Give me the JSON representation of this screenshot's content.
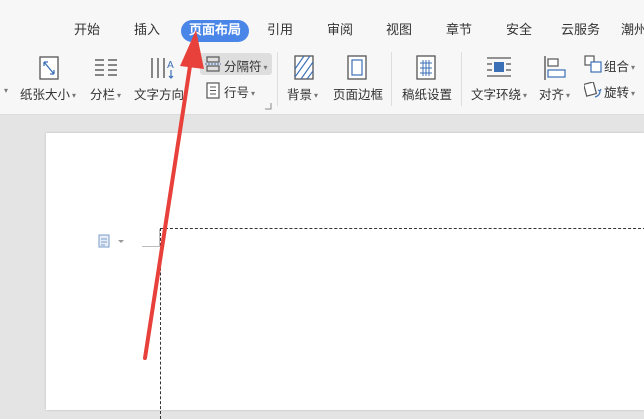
{
  "tabs": [
    {
      "label": "开始"
    },
    {
      "label": "插入"
    },
    {
      "label": "页面布局",
      "active": true
    },
    {
      "label": "引用"
    },
    {
      "label": "审阅"
    },
    {
      "label": "视图"
    },
    {
      "label": "章节"
    },
    {
      "label": "安全"
    },
    {
      "label": "云服务"
    },
    {
      "label": "潮州"
    }
  ],
  "ribbon": {
    "paper_size": "纸张大小",
    "columns": "分栏",
    "text_direction": "文字方向",
    "breaks": "分隔符",
    "line_numbers": "行号",
    "background": "背景",
    "page_border": "页面边框",
    "manuscript_settings": "稿纸设置",
    "text_wrap": "文字环绕",
    "align": "对齐",
    "group": "组合",
    "rotate": "旋转"
  },
  "colors": {
    "active_tab": "#4a86e8",
    "annotation_arrow": "#e8413b",
    "icon_blue": "#3b6fb6"
  }
}
